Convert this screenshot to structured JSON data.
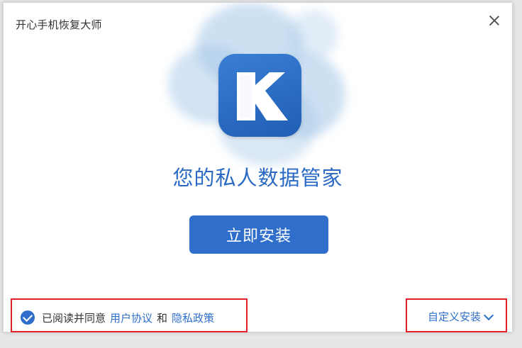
{
  "window": {
    "title": "开心手机恢复大师"
  },
  "icons": {
    "close": "close-icon",
    "logo": "k-logo-icon",
    "check": "checkmark-circle-icon",
    "chevron": "chevron-down-icon"
  },
  "main": {
    "tagline": "您的私人数据管家",
    "install_button": "立即安装"
  },
  "footer": {
    "agree_text": "已阅读并同意",
    "user_agreement": "用户协议",
    "and_text": "和",
    "privacy_policy": "隐私政策",
    "custom_install": "自定义安装"
  },
  "colors": {
    "accent": "#2f6fcb",
    "highlight_box": "#e0202a"
  }
}
